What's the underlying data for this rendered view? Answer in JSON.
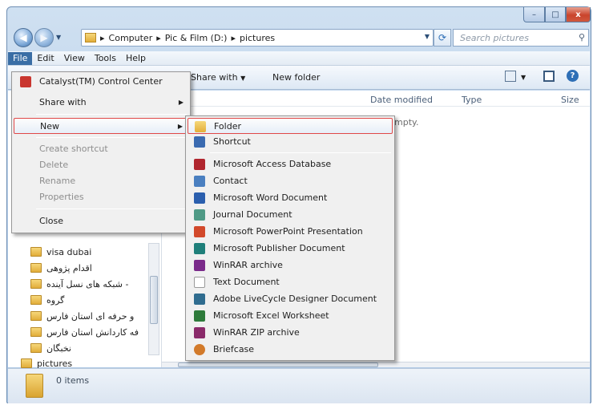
{
  "window": {
    "caption_buttons": {
      "minimize": "–",
      "maximize": "□",
      "close": "x"
    }
  },
  "address": {
    "segments": [
      "Computer",
      "Pic & Film (D:)",
      "pictures"
    ],
    "separator": "▸",
    "search_placeholder": "Search pictures"
  },
  "menubar": [
    "File",
    "Edit",
    "View",
    "Tools",
    "Help"
  ],
  "toolbar": {
    "share_with": "Share with",
    "new_folder": "New folder"
  },
  "columns": {
    "date_modified": "Date modified",
    "type": "Type",
    "size": "Size",
    "empty_text": "mpty."
  },
  "file_menu": {
    "items": [
      {
        "label": "Catalyst(TM) Control Center",
        "state": "normal",
        "icon": "catalyst-icon"
      },
      {
        "label": "Share with",
        "state": "normal",
        "submenu": true
      },
      {
        "label": "New",
        "state": "highlighted",
        "submenu": true
      },
      {
        "label": "Create shortcut",
        "state": "disabled"
      },
      {
        "label": "Delete",
        "state": "disabled"
      },
      {
        "label": "Rename",
        "state": "disabled"
      },
      {
        "label": "Properties",
        "state": "disabled"
      },
      {
        "label": "Close",
        "state": "normal"
      }
    ]
  },
  "new_submenu": {
    "items": [
      {
        "label": "Folder",
        "icon": "folder-icon",
        "color": "#e8b53e"
      },
      {
        "label": "Shortcut",
        "icon": "shortcut-icon",
        "color": "#3a6ab0"
      },
      {
        "label": "Microsoft Access Database",
        "icon": "access-icon",
        "color": "#b0262e"
      },
      {
        "label": "Contact",
        "icon": "contact-icon",
        "color": "#4a7fc0"
      },
      {
        "label": "Microsoft Word Document",
        "icon": "word-icon",
        "color": "#2b5fae"
      },
      {
        "label": "Journal Document",
        "icon": "journal-icon",
        "color": "#4f9a86"
      },
      {
        "label": "Microsoft PowerPoint Presentation",
        "icon": "powerpoint-icon",
        "color": "#d2492b"
      },
      {
        "label": "Microsoft Publisher Document",
        "icon": "publisher-icon",
        "color": "#1f7f7a"
      },
      {
        "label": "WinRAR archive",
        "icon": "winrar-icon",
        "color": "#7a2a8a"
      },
      {
        "label": "Text Document",
        "icon": "text-icon",
        "color": "#d9d9d9"
      },
      {
        "label": "Adobe LiveCycle Designer Document",
        "icon": "livecycle-icon",
        "color": "#2f6c8f"
      },
      {
        "label": "Microsoft Excel Worksheet",
        "icon": "excel-icon",
        "color": "#2d7a3a"
      },
      {
        "label": "WinRAR ZIP archive",
        "icon": "winrar-zip-icon",
        "color": "#8a2a6a"
      },
      {
        "label": "Briefcase",
        "icon": "briefcase-icon",
        "color": "#d27a2a"
      }
    ]
  },
  "tree": {
    "items": [
      {
        "label": "visa dubai"
      },
      {
        "label": "اقدام پژوهی"
      },
      {
        "label": "شبکه های نسل آینده -"
      },
      {
        "label": "گروه"
      },
      {
        "label": "و حرفه ای استان فارس"
      },
      {
        "label": "فه کاردانش استان فارس"
      },
      {
        "label": "نخبگان"
      },
      {
        "label": "pictures"
      }
    ]
  },
  "status": {
    "item_count": "0 items"
  }
}
